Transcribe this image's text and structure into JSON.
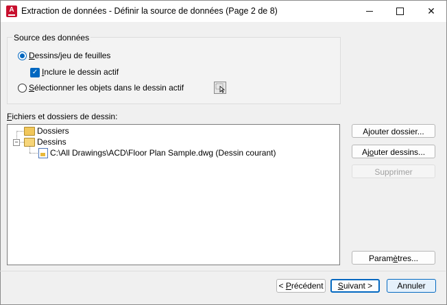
{
  "window": {
    "title": "Extraction de données - Définir la source de données (Page 2 de 8)",
    "app_icon_letter": "A"
  },
  "source_group": {
    "label": "Source des données",
    "option_sheets": {
      "pre": "",
      "key": "D",
      "post": "essins/jeu de feuilles",
      "checked": true
    },
    "include_active": {
      "pre": "",
      "key": "I",
      "post": "nclure le dessin actif",
      "checked": true
    },
    "option_select": {
      "pre": "",
      "key": "S",
      "post": "électionner les objets dans le dessin actif",
      "checked": false
    }
  },
  "files_section": {
    "label_key": "F",
    "label_rest": "ichiers et dossiers de dessin:",
    "tree": {
      "folders_label": "Dossiers",
      "drawings_label": "Dessins",
      "expander_symbol": "−",
      "file_label": "C:\\All Drawings\\ACD\\Floor Plan Sample.dwg (Dessin courant)"
    }
  },
  "side_buttons": {
    "add_folder": {
      "pre": "A",
      "key": "j",
      "post": "outer dossier..."
    },
    "add_drawings": {
      "pre": "Aj",
      "key": "o",
      "post": "uter dessins..."
    },
    "remove": {
      "label": "Supprimer"
    },
    "settings": {
      "pre": "Param",
      "key": "è",
      "post": "tres..."
    }
  },
  "bottom_buttons": {
    "previous": {
      "pre": "< ",
      "key": "P",
      "post": "récédent"
    },
    "next": {
      "pre": "",
      "key": "S",
      "post": "uivant >"
    },
    "cancel": {
      "label": "Annuler"
    }
  },
  "colors": {
    "accent": "#0067c0",
    "app_icon": "#c8102e"
  }
}
